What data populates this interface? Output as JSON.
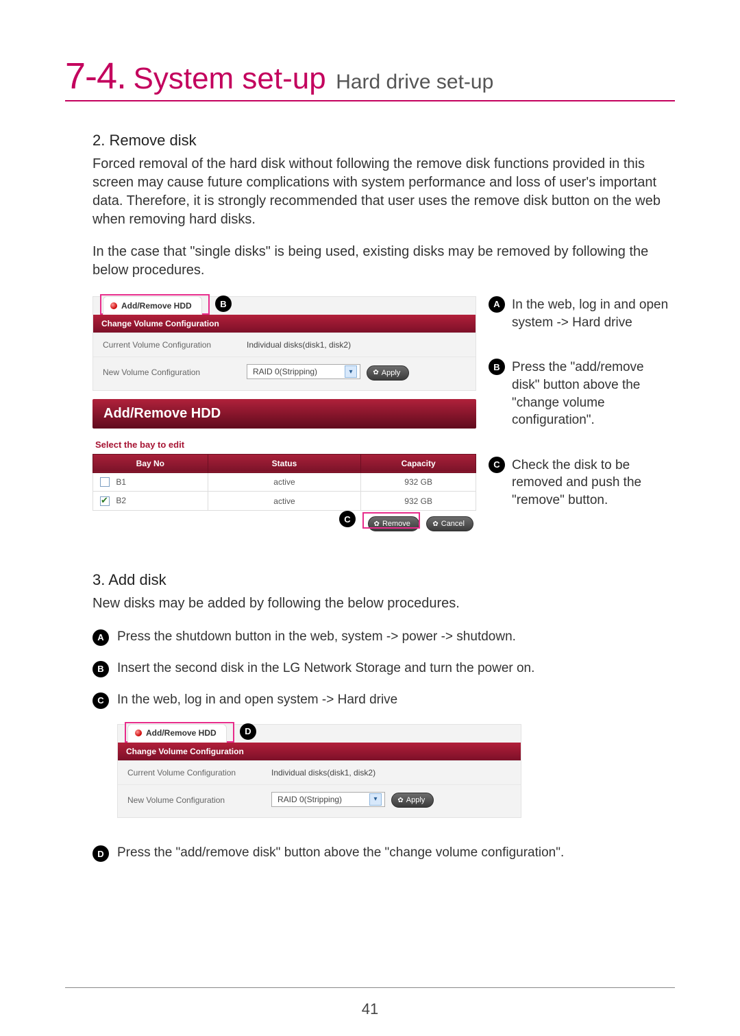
{
  "title": {
    "chapter": "7-4.",
    "main": "System set-up",
    "sub": "Hard drive set-up"
  },
  "remove": {
    "heading": "2. Remove disk",
    "para1": "Forced removal of the hard disk without following the remove disk functions provided in this screen may cause future complications with system performance and loss of user's important data. Therefore, it is strongly recommended that user uses the remove disk button on the web when removing hard disks.",
    "para2": "In the case that \"single disks\" is being used, existing disks may be removed by following the below procedures."
  },
  "panelTop": {
    "tab": "Add/Remove HDD",
    "bar": "Change Volume Configuration",
    "row1k": "Current Volume Configuration",
    "row1v": "Individual disks(disk1, disk2)",
    "row2k": "New Volume Configuration",
    "row2v": "RAID 0(Stripping)",
    "apply": "Apply"
  },
  "panelBay": {
    "title": "Add/Remove HDD",
    "select": "Select the bay to edit",
    "h1": "Bay No",
    "h2": "Status",
    "h3": "Capacity",
    "rows": [
      {
        "bay": "B1",
        "checked": false,
        "status": "active",
        "cap": "932 GB"
      },
      {
        "bay": "B2",
        "checked": true,
        "status": "active",
        "cap": "932 GB"
      }
    ],
    "remove": "Remove",
    "cancel": "Cancel"
  },
  "callouts": {
    "A": "In the web, log in and open system -> Hard drive",
    "B": "Press the \"add/remove disk\" button above the \"change volume configuration\".",
    "C": "Check the disk to be removed and push the \"remove\" button."
  },
  "add": {
    "heading": "3. Add disk",
    "intro": "New disks may be added by following the below procedures.",
    "steps": {
      "A": "Press the shutdown button in the web, system -> power -> shutdown.",
      "B": "Insert the second disk in the LG Network Storage and turn the power on.",
      "C": "In the web, log in and open system -> Hard drive",
      "D": "Press the \"add/remove disk\" button above the \"change volume configuration\"."
    }
  },
  "badges": {
    "A": "A",
    "B": "B",
    "C": "C",
    "D": "D"
  },
  "pageNumber": "41"
}
